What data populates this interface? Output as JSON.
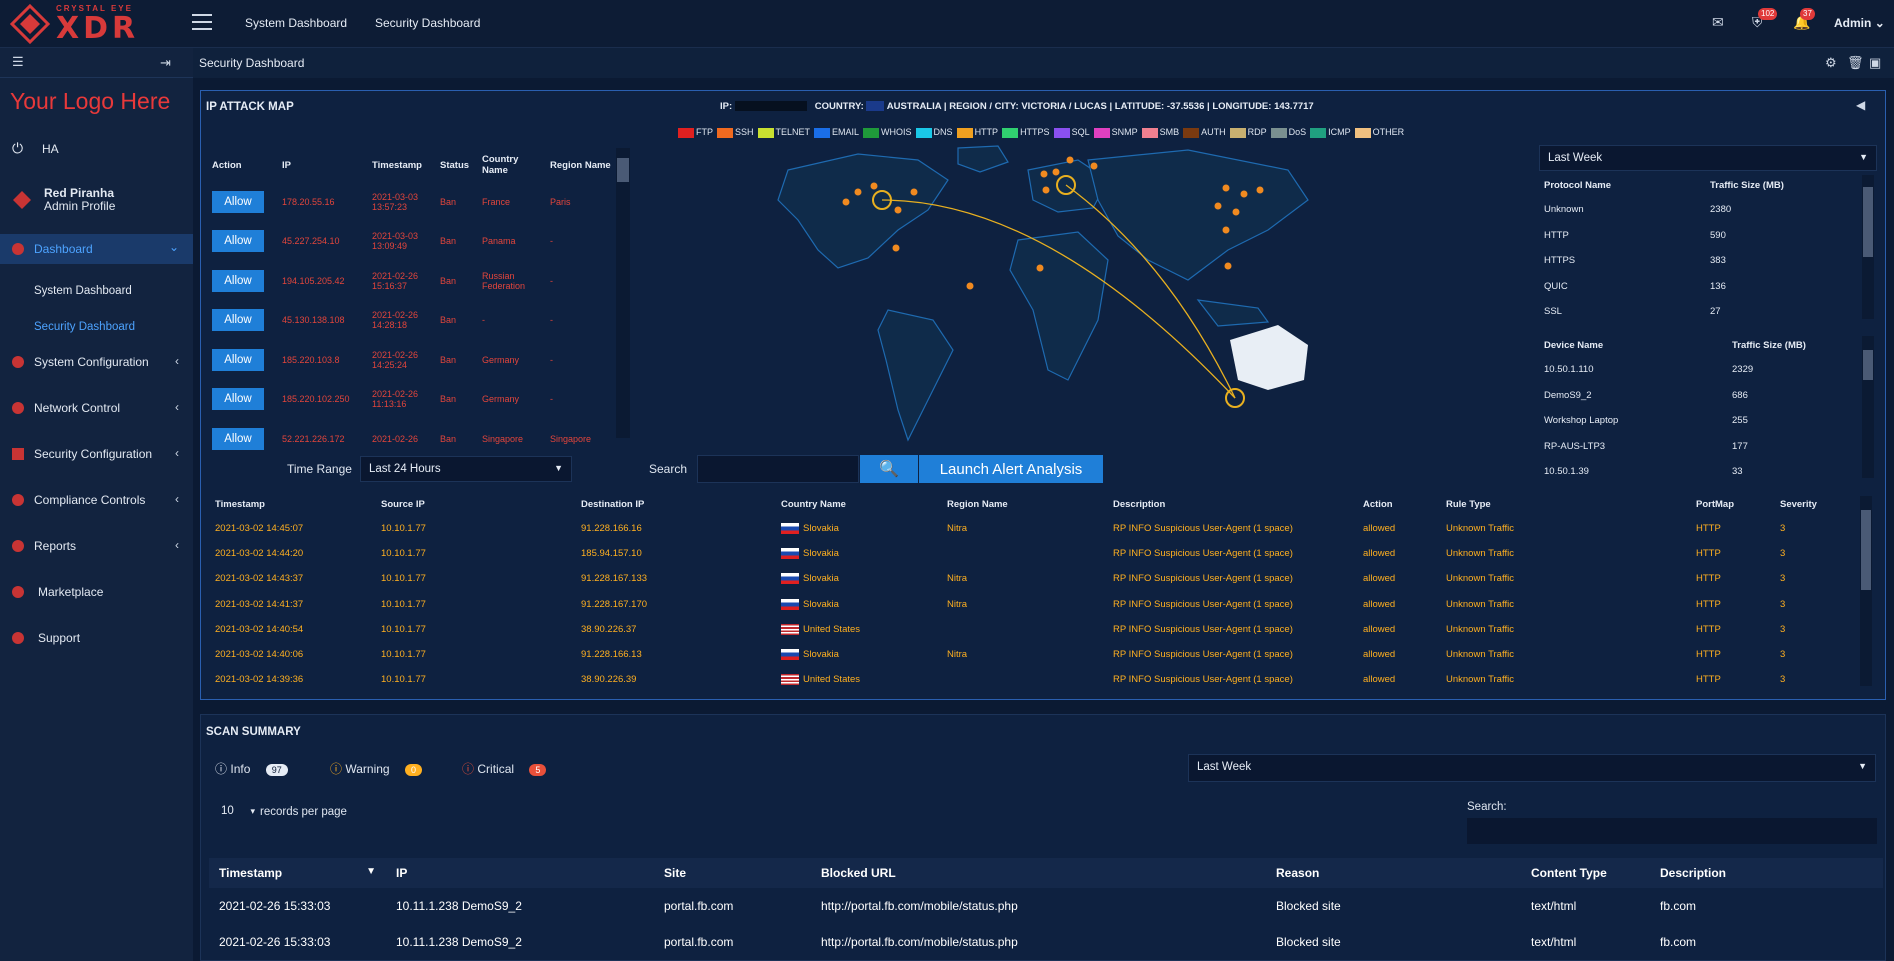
{
  "brand": {
    "top_small": "CRYSTAL EYE",
    "top_big": "XDR",
    "your_logo": "Your Logo Here"
  },
  "nav": {
    "link1": "System Dashboard",
    "link2": "Security Dashboard",
    "badge_shield": "102",
    "badge_bell": "37",
    "admin": "Admin"
  },
  "crumb": "Security Dashboard",
  "sidebar": {
    "ha": "HA",
    "user": "Red Piranha",
    "role": "Admin Profile",
    "dashboard": "Dashboard",
    "sub1": "System Dashboard",
    "sub2": "Security Dashboard",
    "items": [
      "System Configuration",
      "Network Control",
      "Security Configuration",
      "Compliance Controls",
      "Reports",
      "Marketplace",
      "Support"
    ]
  },
  "attack": {
    "title": "IP ATTACK MAP",
    "hdr": {
      "ip_label": "IP:",
      "country_label": "COUNTRY:",
      "country": "AUSTRALIA",
      "region_label": "REGION / CITY:",
      "region": "VICTORIA / LUCAS",
      "lat_label": "LATITUDE:",
      "lat": "-37.5536",
      "lon_label": "LONGITUDE:",
      "lon": "143.7717"
    },
    "legend": [
      {
        "name": "FTP",
        "color": "#e02020"
      },
      {
        "name": "SSH",
        "color": "#f06a20"
      },
      {
        "name": "TELNET",
        "color": "#c8e030"
      },
      {
        "name": "EMAIL",
        "color": "#1a6ee8"
      },
      {
        "name": "WHOIS",
        "color": "#1f9a3a"
      },
      {
        "name": "DNS",
        "color": "#1ac8e8"
      },
      {
        "name": "HTTP",
        "color": "#f0a020"
      },
      {
        "name": "HTTPS",
        "color": "#30d070"
      },
      {
        "name": "SQL",
        "color": "#8a50f0"
      },
      {
        "name": "SNMP",
        "color": "#e040c0"
      },
      {
        "name": "SMB",
        "color": "#f08090"
      },
      {
        "name": "AUTH",
        "color": "#7a3a10"
      },
      {
        "name": "RDP",
        "color": "#c8b070"
      },
      {
        "name": "DoS",
        "color": "#7a9090"
      },
      {
        "name": "ICMP",
        "color": "#20a080"
      },
      {
        "name": "OTHER",
        "color": "#f0c080"
      }
    ],
    "cols": [
      "Action",
      "IP",
      "Timestamp",
      "Status",
      "Country Name",
      "Region Name"
    ],
    "allow": "Allow",
    "rows": [
      [
        "178.20.55.16",
        "2021-03-03 13:57:23",
        "Ban",
        "France",
        "Paris"
      ],
      [
        "45.227.254.10",
        "2021-03-03 13:09:49",
        "Ban",
        "Panama",
        "-"
      ],
      [
        "194.105.205.42",
        "2021-02-26 15:16:37",
        "Ban",
        "Russian Federation",
        "-"
      ],
      [
        "45.130.138.108",
        "2021-02-26 14:28:18",
        "Ban",
        "-",
        "-"
      ],
      [
        "185.220.103.8",
        "2021-02-26 14:25:24",
        "Ban",
        "Germany",
        "-"
      ],
      [
        "185.220.102.250",
        "2021-02-26 11:13:16",
        "Ban",
        "Germany",
        "-"
      ],
      [
        "52.221.226.172",
        "2021-02-26",
        "Ban",
        "Singapore",
        "Singapore"
      ]
    ],
    "time_range_label": "Time Range",
    "time_range": "Last 24 Hours",
    "search_label": "Search",
    "launch": "Launch Alert Analysis",
    "period": "Last Week",
    "proto_cols": [
      "Protocol Name",
      "Traffic Size (MB)"
    ],
    "proto": [
      [
        "Unknown",
        "2380"
      ],
      [
        "HTTP",
        "590"
      ],
      [
        "HTTPS",
        "383"
      ],
      [
        "QUIC",
        "136"
      ],
      [
        "SSL",
        "27"
      ]
    ],
    "dev_cols": [
      "Device Name",
      "Traffic Size (MB)"
    ],
    "dev": [
      [
        "10.50.1.110",
        "2329"
      ],
      [
        "DemoS9_2",
        "686"
      ],
      [
        "Workshop Laptop",
        "255"
      ],
      [
        "RP-AUS-LTP3",
        "177"
      ],
      [
        "10.50.1.39",
        "33"
      ]
    ]
  },
  "events": {
    "cols": [
      "Timestamp",
      "Source IP",
      "Destination IP",
      "Country Name",
      "Region Name",
      "Description",
      "Action",
      "Rule Type",
      "PortMap",
      "Severity"
    ],
    "rows": [
      [
        "2021-03-02 14:45:07",
        "10.10.1.77",
        "91.228.166.16",
        "Slovakia",
        "Nitra",
        "RP INFO Suspicious User-Agent (1 space)",
        "allowed",
        "Unknown Traffic",
        "HTTP",
        "3"
      ],
      [
        "2021-03-02 14:44:20",
        "10.10.1.77",
        "185.94.157.10",
        "Slovakia",
        "",
        "RP INFO Suspicious User-Agent (1 space)",
        "allowed",
        "Unknown Traffic",
        "HTTP",
        "3"
      ],
      [
        "2021-03-02 14:43:37",
        "10.10.1.77",
        "91.228.167.133",
        "Slovakia",
        "Nitra",
        "RP INFO Suspicious User-Agent (1 space)",
        "allowed",
        "Unknown Traffic",
        "HTTP",
        "3"
      ],
      [
        "2021-03-02 14:41:37",
        "10.10.1.77",
        "91.228.167.170",
        "Slovakia",
        "Nitra",
        "RP INFO Suspicious User-Agent (1 space)",
        "allowed",
        "Unknown Traffic",
        "HTTP",
        "3"
      ],
      [
        "2021-03-02 14:40:54",
        "10.10.1.77",
        "38.90.226.37",
        "United States",
        "",
        "RP INFO Suspicious User-Agent (1 space)",
        "allowed",
        "Unknown Traffic",
        "HTTP",
        "3"
      ],
      [
        "2021-03-02 14:40:06",
        "10.10.1.77",
        "91.228.166.13",
        "Slovakia",
        "Nitra",
        "RP INFO Suspicious User-Agent (1 space)",
        "allowed",
        "Unknown Traffic",
        "HTTP",
        "3"
      ],
      [
        "2021-03-02 14:39:36",
        "10.10.1.77",
        "38.90.226.39",
        "United States",
        "",
        "RP INFO Suspicious User-Agent (1 space)",
        "allowed",
        "Unknown Traffic",
        "HTTP",
        "3"
      ]
    ]
  },
  "scan": {
    "title": "SCAN SUMMARY",
    "info": "Info",
    "info_n": "97",
    "warning": "Warning",
    "warning_n": "0",
    "critical": "Critical",
    "critical_n": "5",
    "period": "Last Week",
    "per_page": "10",
    "per_page_label": "records per page",
    "search_label": "Search:",
    "cols": [
      "Timestamp",
      "IP",
      "Site",
      "Blocked URL",
      "Reason",
      "Content Type",
      "Description"
    ],
    "rows": [
      [
        "2021-02-26 15:33:03",
        "10.11.1.238 DemoS9_2",
        "portal.fb.com",
        "http://portal.fb.com/mobile/status.php",
        "Blocked site",
        "text/html",
        "fb.com"
      ],
      [
        "2021-02-26 15:33:03",
        "10.11.1.238 DemoS9_2",
        "portal.fb.com",
        "http://portal.fb.com/mobile/status.php",
        "Blocked site",
        "text/html",
        "fb.com"
      ]
    ]
  }
}
